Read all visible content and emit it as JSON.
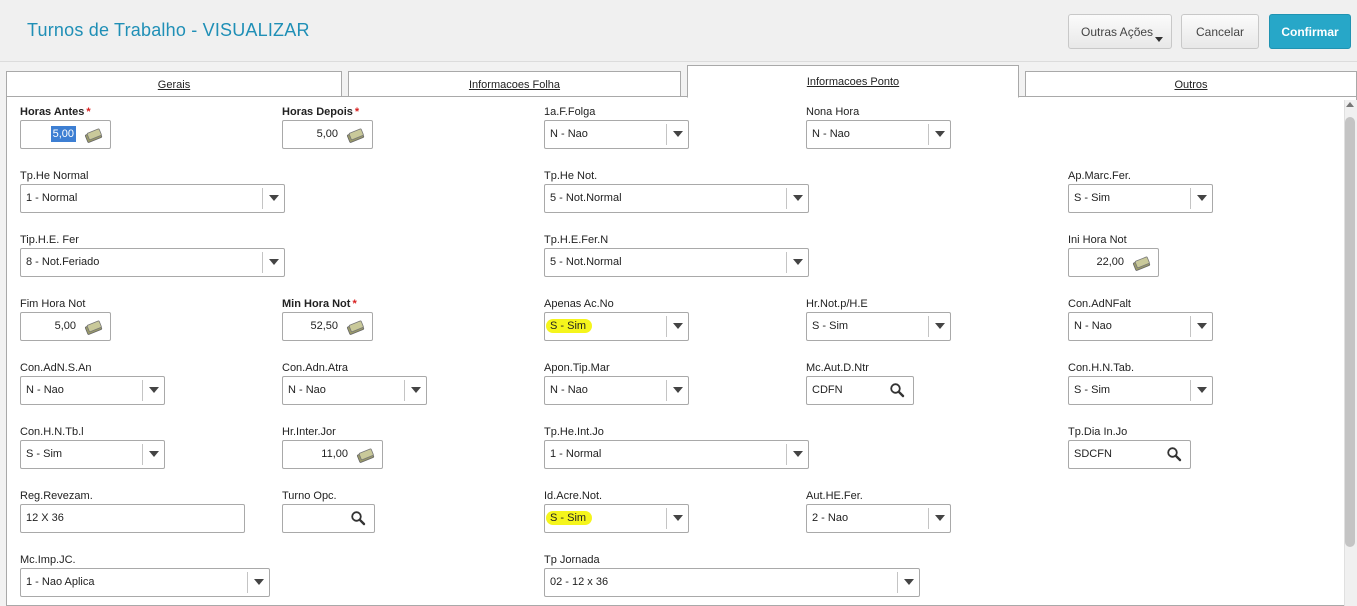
{
  "header": {
    "title": "Turnos de Trabalho - VISUALIZAR",
    "more_actions": "Outras Ações",
    "cancel": "Cancelar",
    "confirm": "Confirmar"
  },
  "tabs": [
    {
      "label": "Gerais"
    },
    {
      "label": "Informacoes Folha"
    },
    {
      "label": "Informacoes Ponto"
    },
    {
      "label": "Outros"
    }
  ],
  "active_tab": "Informacoes Ponto",
  "fields": {
    "horas_antes": {
      "label": "Horas Antes",
      "value": "5,00"
    },
    "horas_depois": {
      "label": "Horas Depois",
      "value": "5,00"
    },
    "folga": {
      "label": "1a.F.Folga",
      "value": "N - Nao"
    },
    "nona_hora": {
      "label": "Nona Hora",
      "value": "N - Nao"
    },
    "tp_he_normal": {
      "label": "Tp.He Normal",
      "value": "1 - Normal"
    },
    "tp_he_not": {
      "label": "Tp.He Not.",
      "value": "5 - Not.Normal"
    },
    "ap_marc_fer": {
      "label": "Ap.Marc.Fer.",
      "value": "S - Sim"
    },
    "tip_he_fer": {
      "label": "Tip.H.E. Fer",
      "value": "8 - Not.Feriado"
    },
    "tp_he_fer_n": {
      "label": "Tp.H.E.Fer.N",
      "value": "5 - Not.Normal"
    },
    "ini_hora_not": {
      "label": "Ini Hora Not",
      "value": "22,00"
    },
    "fim_hora_not": {
      "label": "Fim Hora Not",
      "value": "5,00"
    },
    "min_hora_not": {
      "label": "Min Hora Not",
      "value": "52,50"
    },
    "apenas_ac_no": {
      "label": "Apenas Ac.No",
      "value": "S - Sim"
    },
    "hr_not_he": {
      "label": "Hr.Not.p/H.E",
      "value": "S - Sim"
    },
    "con_adnfalt": {
      "label": "Con.AdNFalt",
      "value": "N - Nao"
    },
    "con_adn_s_an": {
      "label": "Con.AdN.S.An",
      "value": "N - Nao"
    },
    "con_adn_atra": {
      "label": "Con.Adn.Atra",
      "value": "N - Nao"
    },
    "apon_tip_mar": {
      "label": "Apon.Tip.Mar",
      "value": "N - Nao"
    },
    "mc_aut_d_ntr": {
      "label": "Mc.Aut.D.Ntr",
      "value": "CDFN"
    },
    "con_h_n_tab": {
      "label": "Con.H.N.Tab.",
      "value": "S - Sim"
    },
    "con_h_n_tb_l": {
      "label": "Con.H.N.Tb.l",
      "value": "S - Sim"
    },
    "hr_inter_jor": {
      "label": "Hr.Inter.Jor",
      "value": "11,00"
    },
    "tp_he_int_jo": {
      "label": "Tp.He.Int.Jo",
      "value": "1 - Normal"
    },
    "tp_dia_in_jo": {
      "label": "Tp.Dia In.Jo",
      "value": "SDCFN"
    },
    "reg_revezam": {
      "label": "Reg.Revezam.",
      "value": "12 X 36"
    },
    "turno_opc": {
      "label": "Turno Opc.",
      "value": ""
    },
    "id_acre_not": {
      "label": "Id.Acre.Not.",
      "value": "S - Sim"
    },
    "aut_he_fer": {
      "label": "Aut.HE.Fer.",
      "value": "2 - Nao"
    },
    "mc_imp_jc": {
      "label": "Mc.Imp.JC.",
      "value": "1 - Nao Aplica"
    },
    "tp_jornada": {
      "label": "Tp Jornada",
      "value": "02 - 12 x 36"
    }
  },
  "required_mark": "*",
  "icons": {
    "money": "money-icon",
    "search": "search-icon",
    "dropdown": "chevron-down-icon"
  },
  "colors": {
    "title": "#1f8fb6",
    "confirm_bg": "#27a7c8",
    "highlight": "#f5f51c",
    "required": "#d81f1f"
  }
}
